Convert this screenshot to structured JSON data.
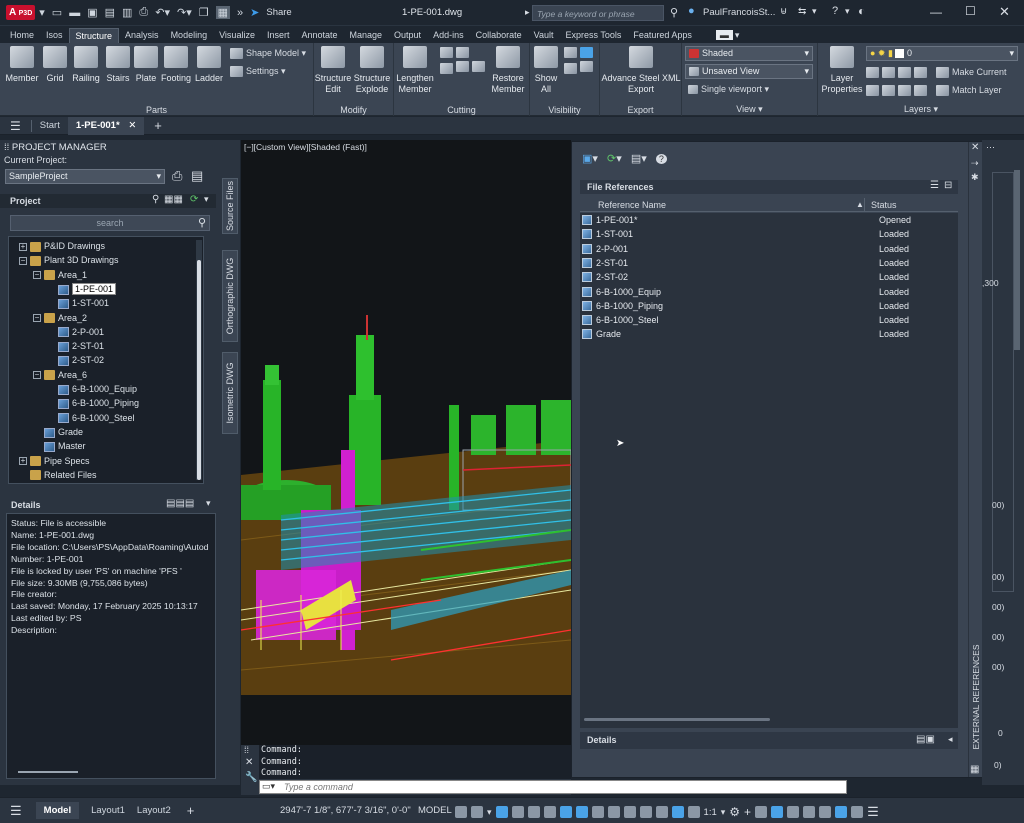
{
  "app": {
    "badge": "A",
    "product_code": "P3D",
    "file_title": "1-PE-001.dwg",
    "share_label": "Share",
    "search_placeholder": "Type a keyword or phrase",
    "user": "PaulFrancoisSt..."
  },
  "ribbon_tabs": [
    "Home",
    "Isos",
    "Structure",
    "Analysis",
    "Modeling",
    "Visualize",
    "Insert",
    "Annotate",
    "Manage",
    "Output",
    "Add-ins",
    "Collaborate",
    "Vault",
    "Express Tools",
    "Featured Apps"
  ],
  "active_tab": "Structure",
  "ribbon": {
    "parts": {
      "title": "Parts",
      "member": "Member",
      "grid": "Grid",
      "railing": "Railing",
      "stairs": "Stairs",
      "plate": "Plate",
      "footing": "Footing",
      "ladder": "Ladder",
      "shape_model": "Shape Model",
      "settings": "Settings"
    },
    "modify": {
      "title": "Modify",
      "structure_edit": [
        "Structure",
        "Edit"
      ],
      "structure_explode": [
        "Structure",
        "Explode"
      ]
    },
    "cutting": {
      "title": "Cutting",
      "lengthen_member": [
        "Lengthen",
        "Member"
      ],
      "restore_member": [
        "Restore",
        "Member"
      ]
    },
    "visibility": {
      "title": "Visibility",
      "show_all": [
        "Show",
        "All"
      ]
    },
    "export": {
      "title": "Export",
      "advance_steel": [
        "Advance Steel XML",
        "Export"
      ]
    },
    "view": {
      "title": "View",
      "visual_style": "Shaded",
      "saved_view": "Unsaved View",
      "viewport": "Single viewport"
    },
    "layers": {
      "title": "Layers",
      "layer_properties": [
        "Layer",
        "Properties"
      ],
      "layer_value": "0",
      "make_current": "Make Current",
      "match_layer": "Match Layer"
    }
  },
  "doc_tabs": {
    "start": "Start",
    "active": "1-PE-001*"
  },
  "project_manager": {
    "title": "PROJECT MANAGER",
    "current_project_label": "Current Project:",
    "current_project": "SampleProject",
    "project_label": "Project",
    "search_placeholder": "search",
    "tree": [
      {
        "label": "P&ID Drawings",
        "level": 0,
        "type": "folder",
        "exp": "+"
      },
      {
        "label": "Plant 3D Drawings",
        "level": 0,
        "type": "folder",
        "exp": "-"
      },
      {
        "label": "Area_1",
        "level": 1,
        "type": "folder",
        "exp": "-"
      },
      {
        "label": "1-PE-001",
        "level": 2,
        "type": "dwg",
        "selected": true
      },
      {
        "label": "1-ST-001",
        "level": 2,
        "type": "dwg"
      },
      {
        "label": "Area_2",
        "level": 1,
        "type": "folder",
        "exp": "-"
      },
      {
        "label": "2-P-001",
        "level": 2,
        "type": "dwg"
      },
      {
        "label": "2-ST-01",
        "level": 2,
        "type": "dwg"
      },
      {
        "label": "2-ST-02",
        "level": 2,
        "type": "dwg"
      },
      {
        "label": "Area_6",
        "level": 1,
        "type": "folder",
        "exp": "-"
      },
      {
        "label": "6-B-1000_Equip",
        "level": 2,
        "type": "dwg"
      },
      {
        "label": "6-B-1000_Piping",
        "level": 2,
        "type": "dwg"
      },
      {
        "label": "6-B-1000_Steel",
        "level": 2,
        "type": "dwg"
      },
      {
        "label": "Grade",
        "level": 1,
        "type": "dwg"
      },
      {
        "label": "Master",
        "level": 1,
        "type": "dwg"
      },
      {
        "label": "Pipe Specs",
        "level": 0,
        "type": "folder",
        "exp": "+"
      },
      {
        "label": "Related Files",
        "level": 0,
        "type": "folder"
      }
    ],
    "side_tabs": [
      "Source Files",
      "Orthographic DWG",
      "Isometric DWG"
    ],
    "details_title": "Details",
    "details": [
      "Status: File is accessible",
      "Name:  1-PE-001.dwg",
      "File location:  C:\\Users\\PS\\AppData\\Roaming\\Autod",
      "Number:  1-PE-001",
      "File is locked by user 'PS' on machine 'PFS '",
      "File size: 9.30MB (9,755,086 bytes)",
      "File creator:",
      "Last saved: Monday, 17 February 2025 10:13:17",
      "Last edited by: PS",
      "Description:"
    ]
  },
  "viewport": {
    "label": "[−][Custom View][Shaded (Fast)]"
  },
  "xref": {
    "title": "File References",
    "col_name": "Reference Name",
    "col_status": "Status",
    "rows": [
      {
        "name": "1-PE-001*",
        "status": "Opened"
      },
      {
        "name": "1-ST-001",
        "status": "Loaded"
      },
      {
        "name": "2-P-001",
        "status": "Loaded"
      },
      {
        "name": "2-ST-01",
        "status": "Loaded"
      },
      {
        "name": "2-ST-02",
        "status": "Loaded"
      },
      {
        "name": "6-B-1000_Equip",
        "status": "Loaded"
      },
      {
        "name": "6-B-1000_Piping",
        "status": "Loaded"
      },
      {
        "name": "6-B-1000_Steel",
        "status": "Loaded"
      },
      {
        "name": "Grade",
        "status": "Loaded"
      }
    ],
    "details_label": "Details",
    "side_title": "EXTERNAL REFERENCES"
  },
  "right_strip": {
    "labels": [
      ",300",
      "00)",
      "00)",
      "00)",
      "00)",
      "00)",
      "0",
      "0)"
    ]
  },
  "command": {
    "lines": [
      "Command:",
      "Command:",
      "Command:"
    ],
    "placeholder": "Type a command"
  },
  "status": {
    "tabs": [
      "Model",
      "Layout1",
      "Layout2"
    ],
    "coords": "2947'-7 1/8\", 677'-7 3/16\", 0'-0\"",
    "space": "MODEL",
    "scale": "1:1"
  }
}
